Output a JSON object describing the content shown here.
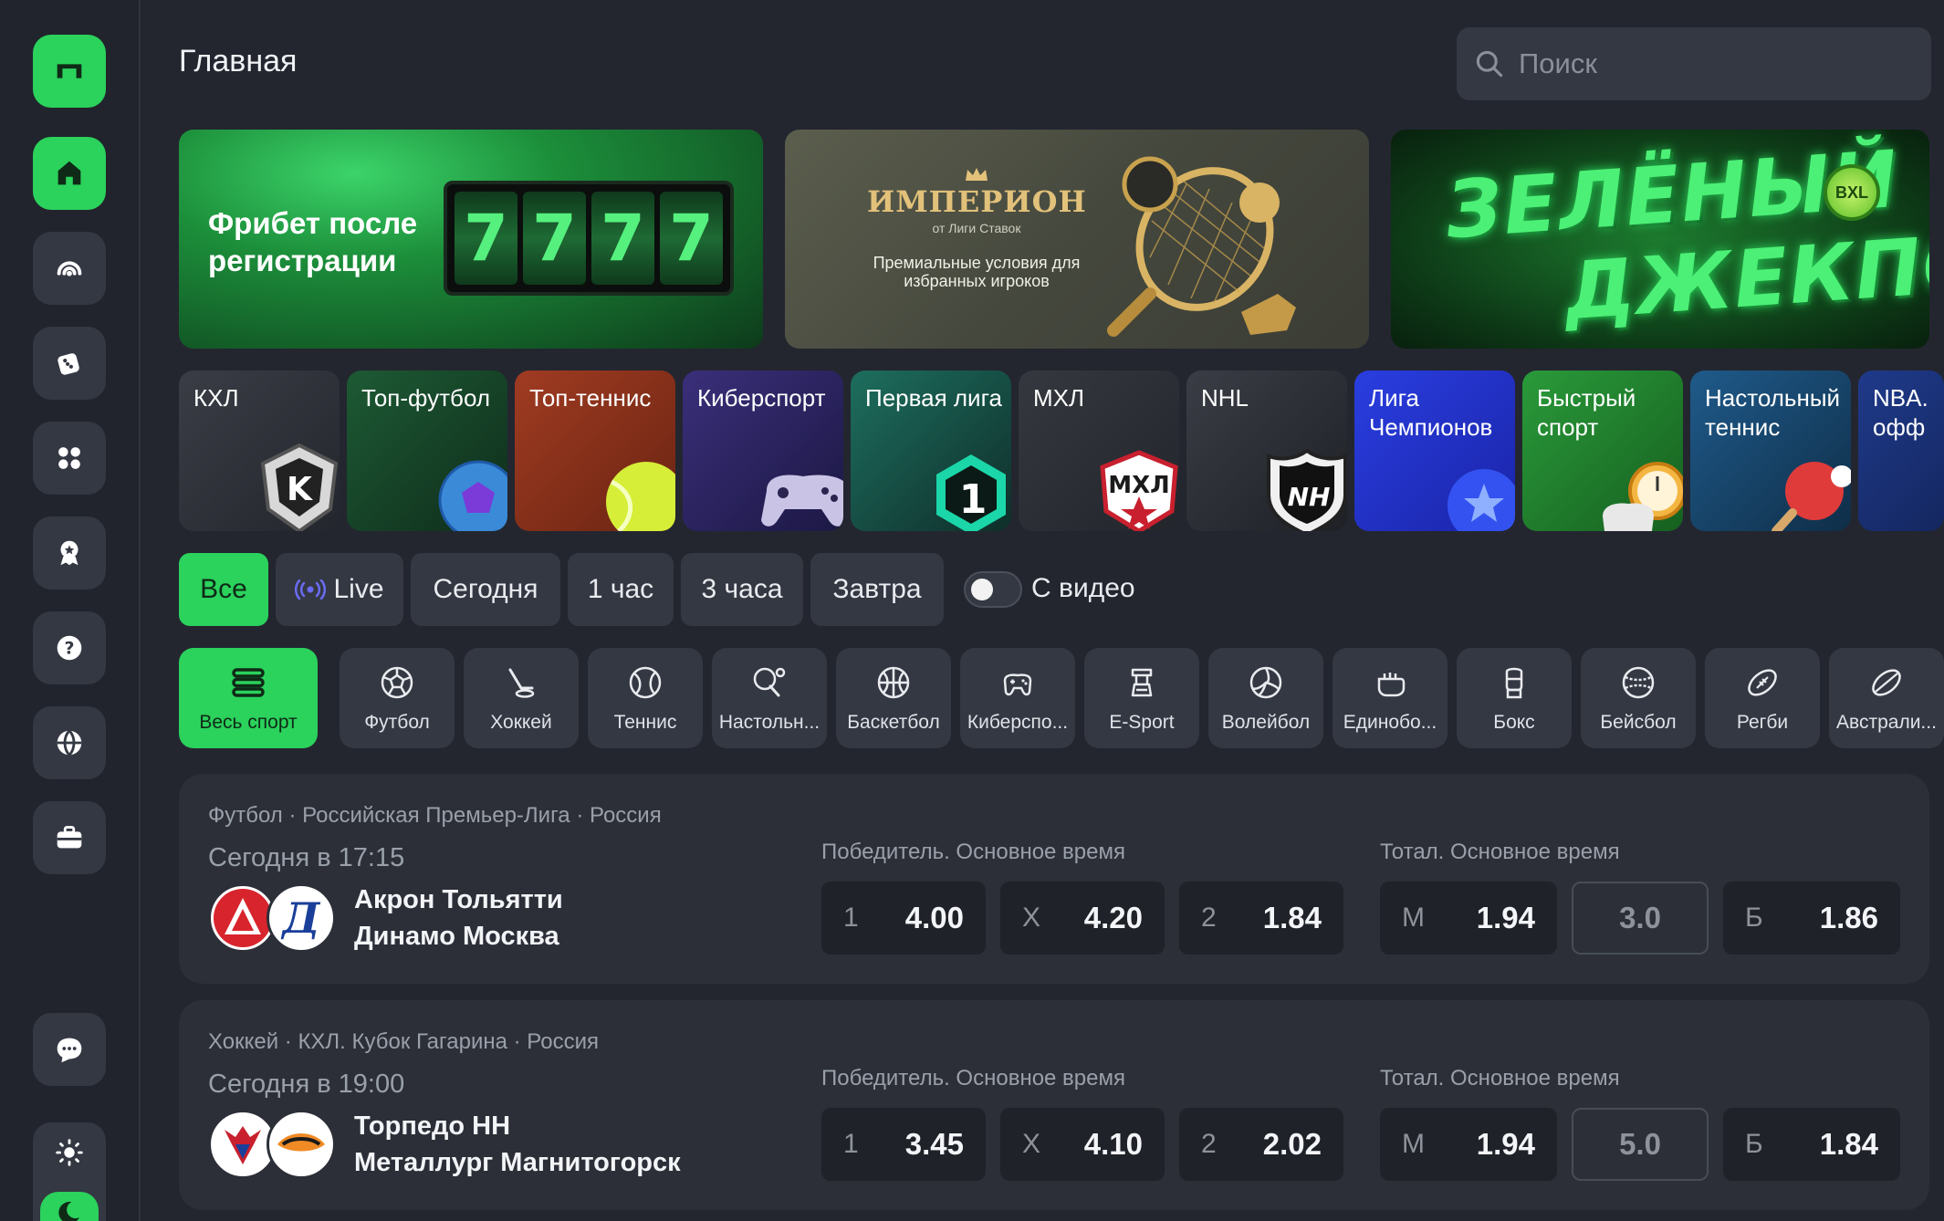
{
  "header": {
    "title": "Главная",
    "search_placeholder": "Поиск"
  },
  "banners": {
    "freebet": "Фрибет после регистрации",
    "slot_symbols": [
      "7",
      "7",
      "7",
      "7"
    ],
    "imperion_brand": "ИМПЕРИОН",
    "imperion_sub": "от Лиги Ставок",
    "imperion_desc": "Премиальные условия для избранных игроков",
    "jackpot_line1": "ЗЕЛЁНЫЙ",
    "jackpot_line2": "ДЖЕКПОТ",
    "jackpot_coin": "BXL"
  },
  "categories": [
    {
      "label": "КХЛ"
    },
    {
      "label": "Топ-футбол"
    },
    {
      "label": "Топ-теннис"
    },
    {
      "label": "Киберспорт"
    },
    {
      "label": "Первая лига"
    },
    {
      "label": "МХЛ"
    },
    {
      "label": "NHL"
    },
    {
      "label": "Лига Чемпионов"
    },
    {
      "label": "Быстрый спорт"
    },
    {
      "label": "Настольный теннис"
    },
    {
      "label": "NBA. офф"
    }
  ],
  "filters": {
    "all": "Все",
    "live": "Live",
    "today": "Сегодня",
    "hour1": "1 час",
    "hour3": "3 часа",
    "tomorrow": "Завтра",
    "video_label": "С видео",
    "video_enabled": false
  },
  "sports": [
    {
      "label": "Весь спорт",
      "icon": "all-sports-icon"
    },
    {
      "label": "Футбол",
      "icon": "football-icon"
    },
    {
      "label": "Хоккей",
      "icon": "hockey-icon"
    },
    {
      "label": "Теннис",
      "icon": "tennis-icon"
    },
    {
      "label": "Настольн...",
      "icon": "table-tennis-icon"
    },
    {
      "label": "Баскетбол",
      "icon": "basketball-icon"
    },
    {
      "label": "Киберспо...",
      "icon": "gamepad-icon"
    },
    {
      "label": "E-Sport",
      "icon": "esport-icon"
    },
    {
      "label": "Волейбол",
      "icon": "volleyball-icon"
    },
    {
      "label": "Единобо...",
      "icon": "fist-icon"
    },
    {
      "label": "Бокс",
      "icon": "boxing-glove-icon"
    },
    {
      "label": "Бейсбол",
      "icon": "baseball-icon"
    },
    {
      "label": "Регби",
      "icon": "rugby-icon"
    },
    {
      "label": "Австрали...",
      "icon": "aussie-ball-icon"
    }
  ],
  "matches": [
    {
      "league": "Футбол · Российская Премьер-Лига · Россия",
      "time": "Сегодня в 17:15",
      "team1": "Акрон Тольятти",
      "team2": "Динамо Москва",
      "winner_title": "Победитель. Основное время",
      "total_title": "Тотал. Основное время",
      "odds": {
        "k1": "1",
        "v1": "4.00",
        "kx": "X",
        "vx": "4.20",
        "k2": "2",
        "v2": "1.84"
      },
      "total": {
        "km": "М",
        "vm": "1.94",
        "line": "3.0",
        "kb": "Б",
        "vb": "1.86"
      }
    },
    {
      "league": "Хоккей · КХЛ. Кубок Гагарина · Россия",
      "time": "Сегодня в 19:00",
      "team1": "Торпедо НН",
      "team2": "Металлург Магнитогорск",
      "winner_title": "Победитель. Основное время",
      "total_title": "Тотал. Основное время",
      "odds": {
        "k1": "1",
        "v1": "3.45",
        "kx": "X",
        "vx": "4.10",
        "k2": "2",
        "v2": "2.02"
      },
      "total": {
        "km": "М",
        "vm": "1.94",
        "line": "5.0",
        "kb": "Б",
        "vb": "1.84"
      }
    }
  ],
  "colors": {
    "accent": "#2bd25c",
    "bg": "#23262f",
    "card": "#2c2f38",
    "chip": "#343843"
  }
}
